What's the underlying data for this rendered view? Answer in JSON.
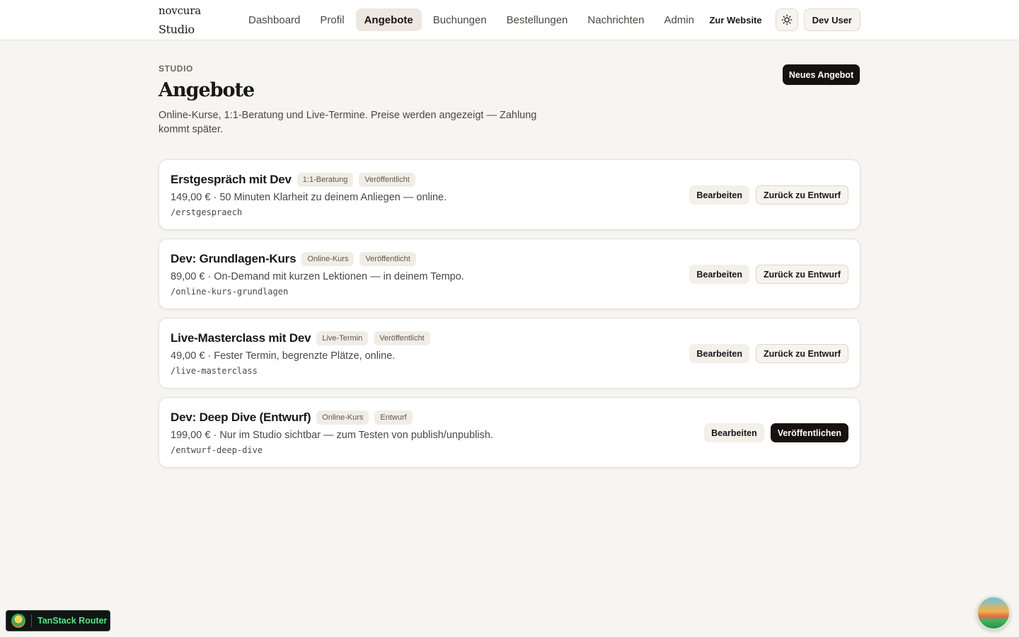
{
  "brand": {
    "line1": "novcura",
    "line2": "Studio"
  },
  "nav": {
    "items": [
      {
        "label": "Dashboard",
        "active": false
      },
      {
        "label": "Profil",
        "active": false
      },
      {
        "label": "Angebote",
        "active": true
      },
      {
        "label": "Buchungen",
        "active": false
      },
      {
        "label": "Bestellungen",
        "active": false
      },
      {
        "label": "Nachrichten",
        "active": false
      },
      {
        "label": "Admin",
        "active": false
      }
    ],
    "website_link": "Zur Website",
    "theme_icon": "sun-icon",
    "user_label": "Dev User"
  },
  "page": {
    "eyebrow": "STUDIO",
    "title": "Angebote",
    "description": "Online-Kurse, 1:1-Beratung und Live-Termine. Preise werden angezeigt — Zahlung kommt später.",
    "new_button": "Neues Angebot"
  },
  "offers": [
    {
      "title": "Erstgespräch mit Dev",
      "type_badge": "1:1-Beratung",
      "status_badge": "Veröffentlicht",
      "description": "149,00 € · 50 Minuten Klarheit zu deinem Anliegen — online.",
      "slug": "/erstgespraech",
      "edit_label": "Bearbeiten",
      "toggle_label": "Zurück zu Entwurf"
    },
    {
      "title": "Dev: Grundlagen-Kurs",
      "type_badge": "Online-Kurs",
      "status_badge": "Veröffentlicht",
      "description": "89,00 € · On-Demand mit kurzen Lektionen — in deinem Tempo.",
      "slug": "/online-kurs-grundlagen",
      "edit_label": "Bearbeiten",
      "toggle_label": "Zurück zu Entwurf"
    },
    {
      "title": "Live-Masterclass mit Dev",
      "type_badge": "Live-Termin",
      "status_badge": "Veröffentlicht",
      "description": "49,00 € · Fester Termin, begrenzte Plätze, online.",
      "slug": "/live-masterclass",
      "edit_label": "Bearbeiten",
      "toggle_label": "Zurück zu Entwurf"
    },
    {
      "title": "Dev: Deep Dive (Entwurf)",
      "type_badge": "Online-Kurs",
      "status_badge": "Entwurf",
      "description": "199,00 € · Nur im Studio sichtbar — zum Testen von publish/unpublish.",
      "slug": "/entwurf-deep-dive",
      "edit_label": "Bearbeiten",
      "toggle_label": "Veröffentlichen"
    }
  ],
  "devtools": {
    "label": "TanStack Router"
  }
}
